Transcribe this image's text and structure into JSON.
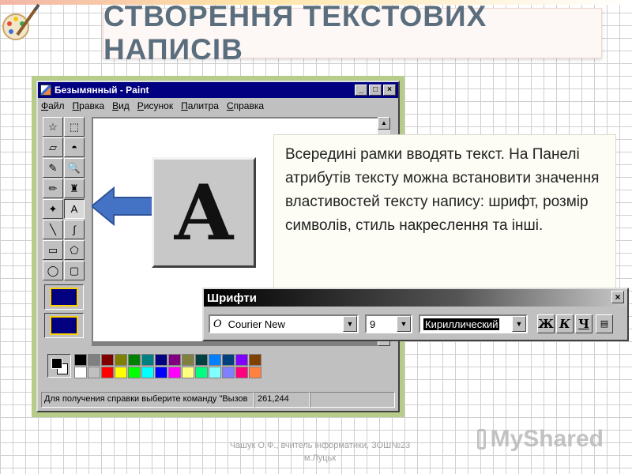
{
  "slide": {
    "title": "СТВОРЕННЯ ТЕКСТОВИХ НАПИСІВ",
    "info_text": "Всередині рамки вводять текст. На Панелі атрибутів тексту можна встановити значення властивостей тексту напису: шрифт, розмір символів, стиль накреслення та інші.",
    "credit": "Чашук О.Ф., вчитель інформатики, ЗОШ№23 м.Луцьк",
    "watermark": "MyShared"
  },
  "paint": {
    "window_title": "Безымянный - Paint",
    "title_buttons": [
      "_",
      "□",
      "×"
    ],
    "menu": [
      "Файл",
      "Правка",
      "Вид",
      "Рисунок",
      "Палитра",
      "Справка"
    ],
    "tools": [
      {
        "name": "free-select-icon",
        "glyph": "☆"
      },
      {
        "name": "select-icon",
        "glyph": "⬚"
      },
      {
        "name": "eraser-icon",
        "glyph": "▱"
      },
      {
        "name": "fill-icon",
        "glyph": "◓"
      },
      {
        "name": "color-picker-icon",
        "glyph": "✎"
      },
      {
        "name": "magnifier-icon",
        "glyph": "🔍"
      },
      {
        "name": "pencil-icon",
        "glyph": "✏"
      },
      {
        "name": "brush-icon",
        "glyph": "♜"
      },
      {
        "name": "airbrush-icon",
        "glyph": "✦"
      },
      {
        "name": "text-icon",
        "glyph": "A"
      },
      {
        "name": "line-icon",
        "glyph": "╲"
      },
      {
        "name": "curve-icon",
        "glyph": "∫"
      },
      {
        "name": "rectangle-icon",
        "glyph": "▭"
      },
      {
        "name": "polygon-icon",
        "glyph": "⬠"
      },
      {
        "name": "ellipse-icon",
        "glyph": "◯"
      },
      {
        "name": "rounded-rect-icon",
        "glyph": "▢"
      }
    ],
    "palette_row1": [
      "#000000",
      "#808080",
      "#800000",
      "#808000",
      "#008000",
      "#008080",
      "#000080",
      "#800080",
      "#808040",
      "#004040",
      "#0080ff",
      "#004080",
      "#8000ff",
      "#804000"
    ],
    "palette_row2": [
      "#ffffff",
      "#c0c0c0",
      "#ff0000",
      "#ffff00",
      "#00ff00",
      "#00ffff",
      "#0000ff",
      "#ff00ff",
      "#ffff80",
      "#00ff80",
      "#80ffff",
      "#8080ff",
      "#ff0080",
      "#ff8040"
    ],
    "status_help": "Для получения справки выберите команду \"Вызов",
    "status_coords": "261,244"
  },
  "fonts_toolbar": {
    "title": "Шрифти",
    "close": "×",
    "font_name": "Courier New",
    "font_prefix": "O",
    "size": "9",
    "charset": "Кириллический",
    "bold": "Ж",
    "italic": "К",
    "underline": "Ч"
  },
  "big_letter": "A",
  "colors": {
    "title": "#5b6e7e",
    "paint_titlebar": "#000080",
    "frame_green": "#b8cc8a",
    "arrow_blue": "#4472c4"
  }
}
